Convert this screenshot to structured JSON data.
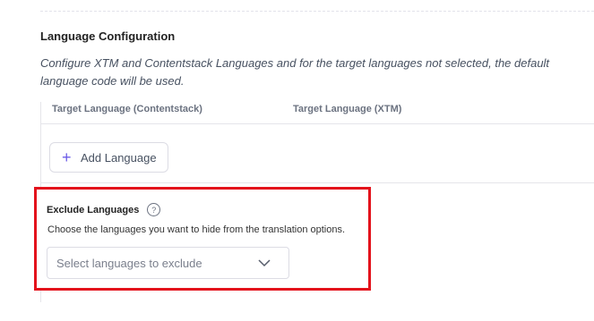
{
  "section": {
    "title": "Language Configuration",
    "description": "Configure XTM and Contentstack Languages and for the target languages not selected, the default language code will be used."
  },
  "table": {
    "columns": [
      "Target Language (Contentstack)",
      "Target Language (XTM)"
    ],
    "add_button_label": "Add Language",
    "add_icon": "+"
  },
  "exclude": {
    "title": "Exclude Languages",
    "help_icon": "?",
    "description": "Choose the languages you want to hide from the translation options.",
    "select_placeholder": "Select languages to exclude"
  },
  "colors": {
    "highlight_border": "#e3131c",
    "accent": "#6c5ce7"
  }
}
